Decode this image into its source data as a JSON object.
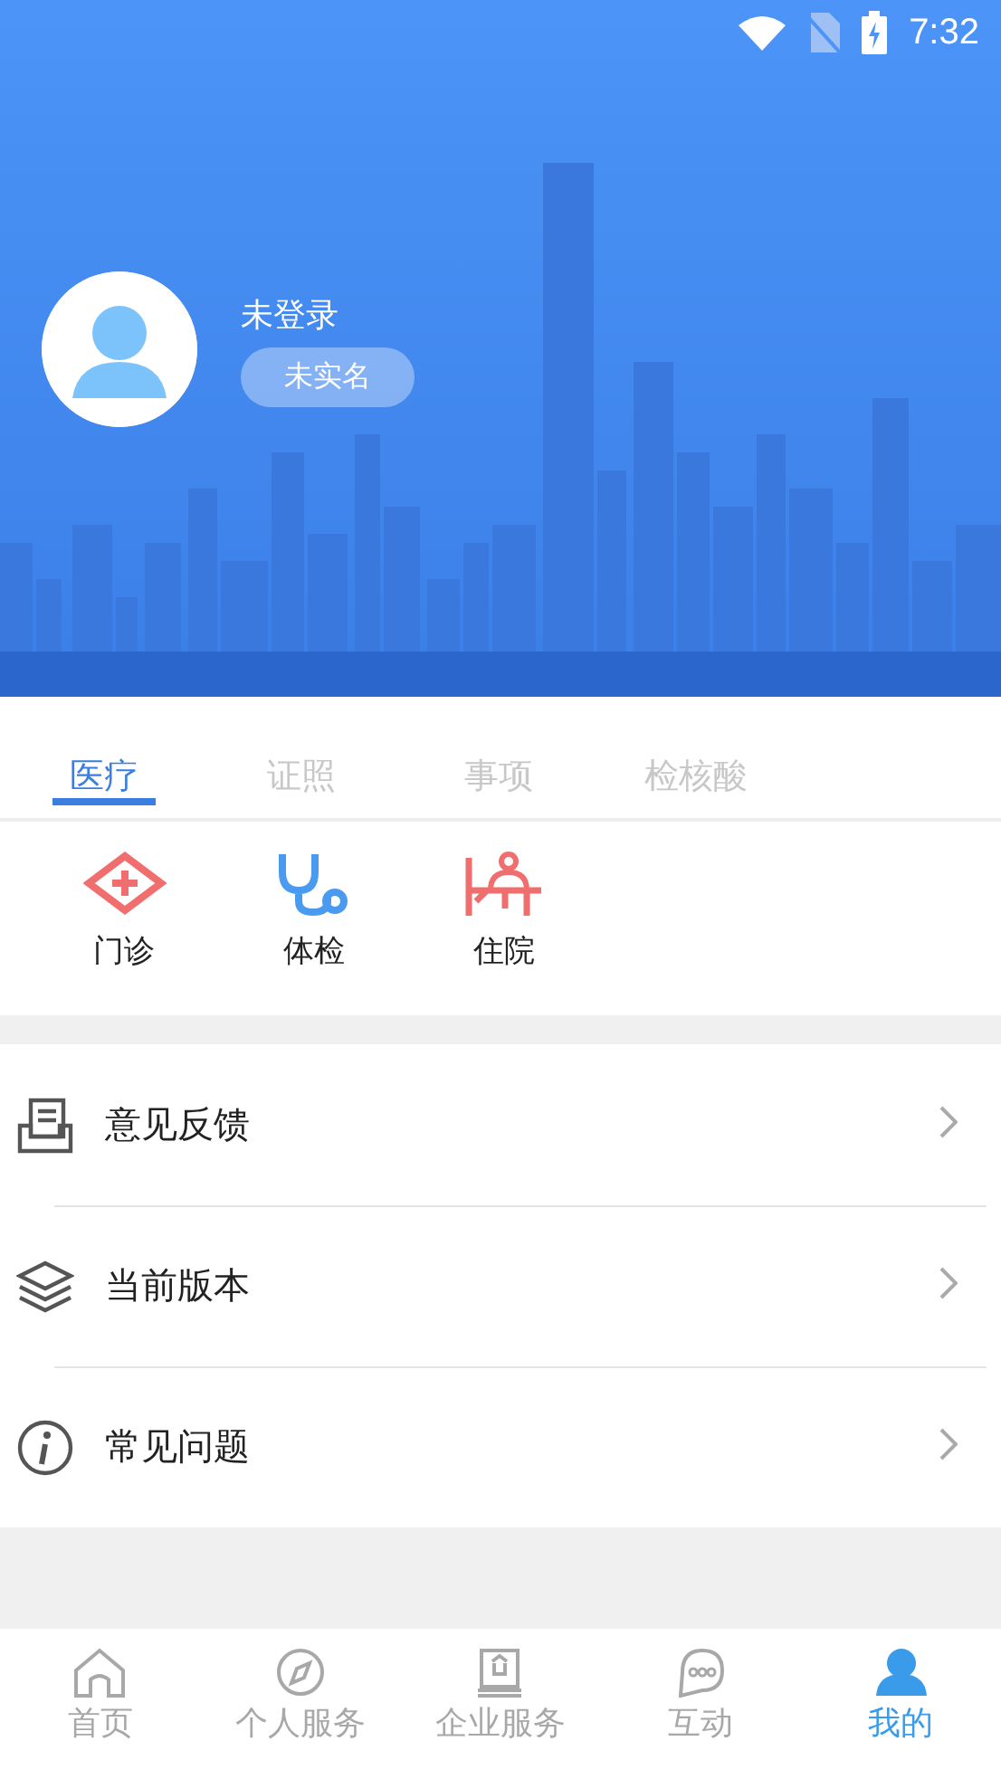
{
  "status_bar": {
    "time": "7:32"
  },
  "profile": {
    "name": "未登录",
    "badge": "未实名"
  },
  "tabs": [
    {
      "label": "医疗",
      "selected": true
    },
    {
      "label": "证照",
      "selected": false
    },
    {
      "label": "事项",
      "selected": false
    },
    {
      "label": "检核酸",
      "selected": false
    }
  ],
  "services": [
    {
      "label": "门诊",
      "kind": "clinic"
    },
    {
      "label": "体检",
      "kind": "checkup"
    },
    {
      "label": "住院",
      "kind": "hospital"
    }
  ],
  "menu": [
    {
      "label": "意见反馈",
      "kind": "feedback"
    },
    {
      "label": "当前版本",
      "kind": "version"
    },
    {
      "label": "常见问题",
      "kind": "faq"
    }
  ],
  "bottom_nav": [
    {
      "label": "首页",
      "kind": "home",
      "selected": false
    },
    {
      "label": "个人服务",
      "kind": "compass",
      "selected": false
    },
    {
      "label": "企业服务",
      "kind": "enterprise",
      "selected": false
    },
    {
      "label": "互动",
      "kind": "chat",
      "selected": false
    },
    {
      "label": "我的",
      "kind": "user",
      "selected": true
    }
  ]
}
